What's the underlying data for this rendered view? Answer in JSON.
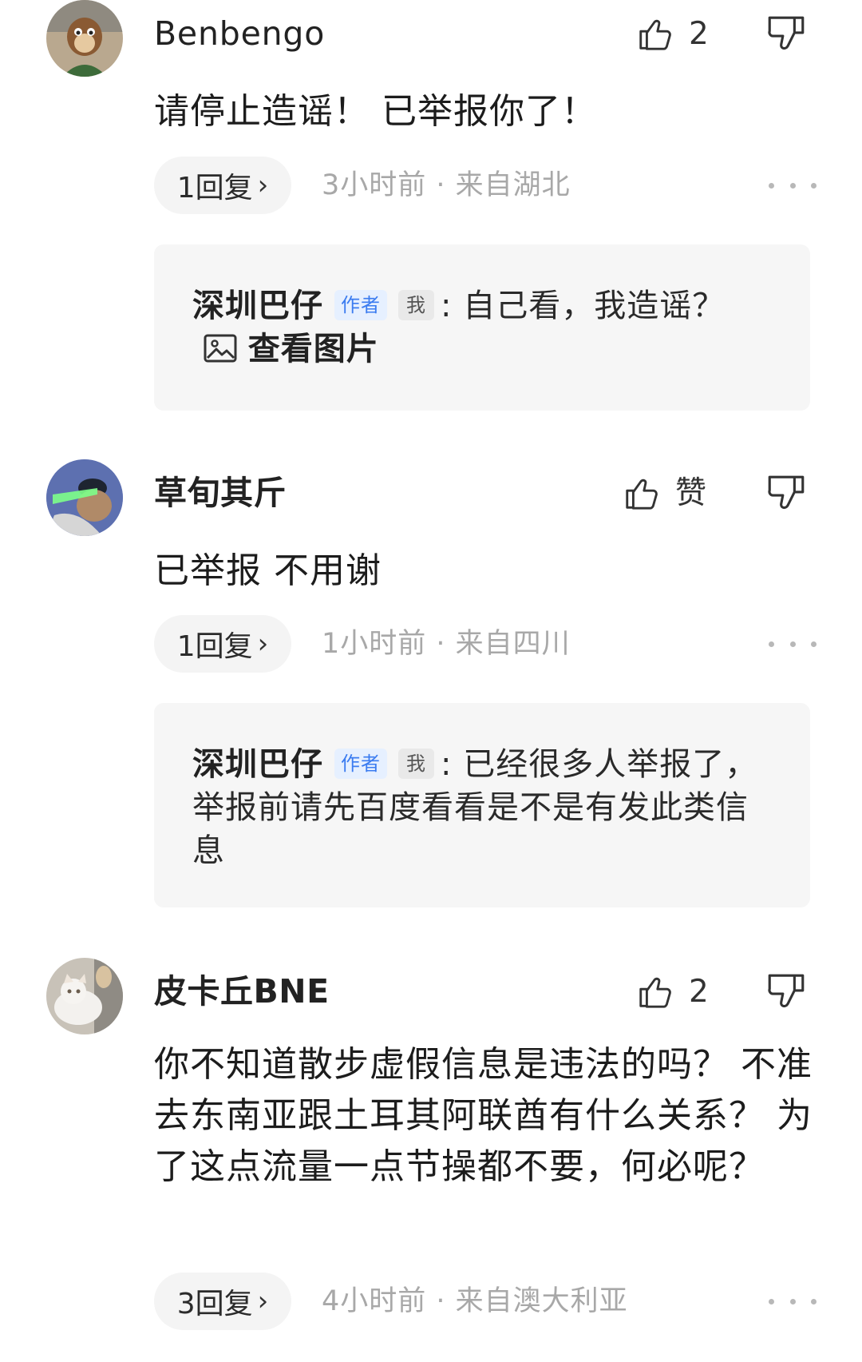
{
  "comments": [
    {
      "username": "Benbengo",
      "likes": "2",
      "content": "请停止造谣！ 已举报你了！",
      "reply_count": "1回复",
      "time": "3小时前",
      "location": "来自湖北",
      "reply": {
        "author": "深圳巴仔",
        "author_tag": "作者",
        "me_tag": "我",
        "text": "自己看，我造谣？",
        "view_image": "查看图片"
      }
    },
    {
      "username": "草旬其斤",
      "likes": "赞",
      "content": "已举报 不用谢",
      "reply_count": "1回复",
      "time": "1小时前",
      "location": "来自四川",
      "reply": {
        "author": "深圳巴仔",
        "author_tag": "作者",
        "me_tag": "我",
        "text": "已经很多人举报了，举报前请先百度看看是不是有发此类信息"
      }
    },
    {
      "username": "皮卡丘BNE",
      "likes": "2",
      "content": "你不知道散步虚假信息是违法的吗？ 不准去东南亚跟土耳其阿联酋有什么关系？ 为了这点流量一点节操都不要，何必呢？",
      "reply_count": "3回复",
      "time": "4小时前",
      "location": "来自澳大利亚"
    }
  ],
  "separator": " · ",
  "colon": ": ",
  "chevron": "›",
  "icons": {
    "like": "thumbs-up-icon",
    "dislike": "thumbs-down-icon",
    "more": "more-dots-icon",
    "image": "image-icon",
    "chevron": "chevron-right-icon"
  },
  "colors": {
    "author_tag_bg": "#e6f0ff",
    "author_tag_text": "#3b7cf0",
    "meta_text": "#a8a8a8",
    "reply_bg": "#f6f6f6",
    "pill_bg": "#f4f4f4"
  }
}
